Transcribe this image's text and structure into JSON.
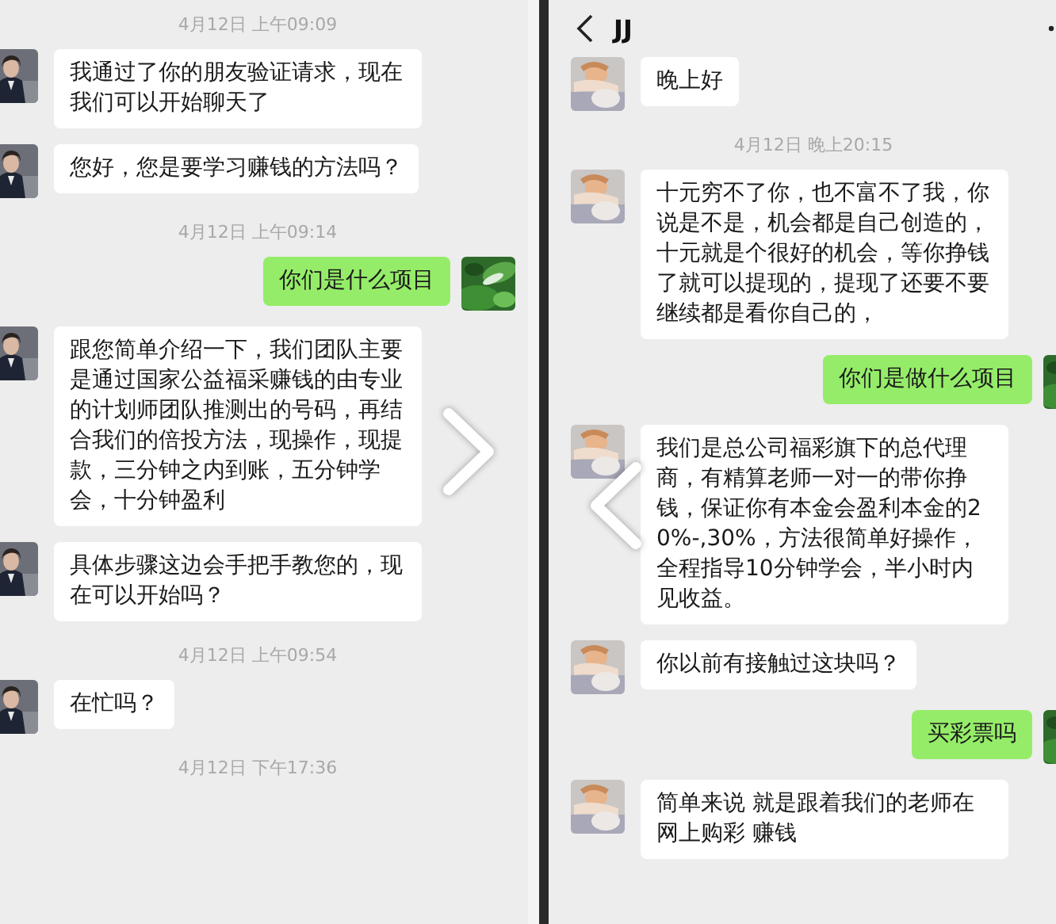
{
  "panels": [
    {
      "messages": [
        {
          "kind": "time",
          "text": "4月12日 上午09:09"
        },
        {
          "kind": "in",
          "text": "我通过了你的朋友验证请求，现在我们可以开始聊天了"
        },
        {
          "kind": "in",
          "text": "您好，您是要学习赚钱的方法吗？"
        },
        {
          "kind": "time",
          "text": "4月12日 上午09:14"
        },
        {
          "kind": "out",
          "text": "你们是什么项目"
        },
        {
          "kind": "in",
          "text": "跟您简单介绍一下，我们团队主要是通过国家公益福采赚钱的由专业的计划师团队推测出的号码，再结合我们的倍投方法，现操作，现提款，三分钟之内到账，五分钟学会，十分钟盈利"
        },
        {
          "kind": "in",
          "text": "具体步骤这边会手把手教您的，现在可以开始吗？"
        },
        {
          "kind": "time",
          "text": "4月12日 上午09:54"
        },
        {
          "kind": "in",
          "text": "在忙吗？"
        },
        {
          "kind": "time",
          "text": "4月12日 下午17:36"
        }
      ]
    },
    {
      "header": {
        "title": "JJ"
      },
      "messages": [
        {
          "kind": "in",
          "text": "晚上好"
        },
        {
          "kind": "time",
          "text": "4月12日 晚上20:15"
        },
        {
          "kind": "in",
          "text": "十元穷不了你，也不富不了我，你说是不是，机会都是自己创造的，十元就是个很好的机会，等你挣钱了就可以提现的，提现了还要不要继续都是看你自己的，"
        },
        {
          "kind": "out",
          "text": "你们是做什么项目"
        },
        {
          "kind": "in",
          "text": "我们是总公司福彩旗下的总代理商，有精算老师一对一的带你挣钱，保证你有本金会盈利本金的20%-,30%，方法很简单好操作，全程指导10分钟学会，半小时内见收益。"
        },
        {
          "kind": "in",
          "text": "你以前有接触过这块吗？"
        },
        {
          "kind": "out",
          "text": "买彩票吗"
        },
        {
          "kind": "in",
          "text": "简单来说 就是跟着我们的老师在网上购彩 赚钱"
        }
      ]
    }
  ]
}
